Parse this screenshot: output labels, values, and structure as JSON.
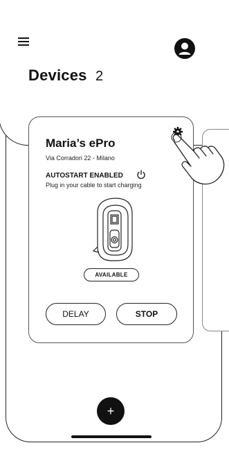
{
  "header": {
    "title": "Devices",
    "count": "2",
    "menu_icon": "hamburger-menu-icon",
    "avatar_icon": "user-avatar-icon"
  },
  "device_card": {
    "name": "Maria’s ePro",
    "address": "Via Corradori 22 - Milano",
    "autostart_label": "AUTOSTART ENABLED",
    "autostart_hint": "Plug in your cable to start charging",
    "status": "AVAILABLE",
    "delay_label": "DELAY",
    "stop_label": "STOP",
    "settings_icon": "gear-icon",
    "power_icon": "power-icon"
  },
  "fab": {
    "label": "+"
  },
  "colors": {
    "ink": "#111111",
    "background": "#ffffff"
  }
}
